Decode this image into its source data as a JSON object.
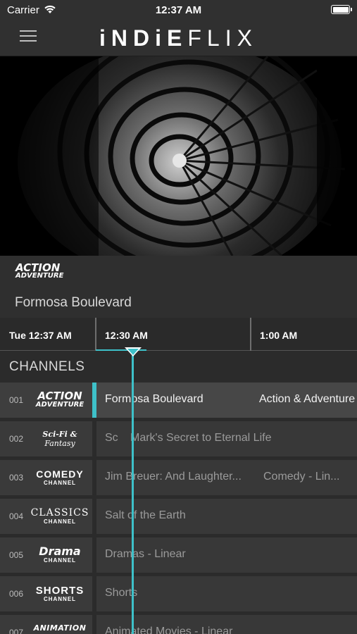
{
  "status_bar": {
    "carrier": "Carrier",
    "time": "12:37 AM"
  },
  "header": {
    "logo_bold": "iNDiE",
    "logo_light": "FLIX"
  },
  "now_playing": {
    "channel_logo_line1": "ACTION",
    "channel_logo_line2": "ADVENTURE",
    "title": "Formosa Boulevard"
  },
  "timeline": {
    "current": "Tue 12:37 AM",
    "slots": [
      "12:30 AM",
      "1:00 AM"
    ]
  },
  "channels_header": "CHANNELS",
  "channels": [
    {
      "number": "001",
      "logo_line1": "ACTION",
      "logo_line2": "ADVENTURE",
      "programs": [
        "Formosa Boulevard",
        "Action & Adventure"
      ],
      "active": true
    },
    {
      "number": "002",
      "logo_line1": "Sci-Fi &",
      "logo_line2": "Fantasy",
      "programs": [
        "Sc",
        "Mark's Secret to Eternal Life"
      ]
    },
    {
      "number": "003",
      "logo_line1": "COMEDY",
      "logo_line2": "CHANNEL",
      "programs": [
        "Jim Breuer: And Laughter...",
        "Comedy - Lin..."
      ]
    },
    {
      "number": "004",
      "logo_line1": "CLASSICS",
      "logo_line2": "CHANNEL",
      "programs": [
        "Salt of the Earth"
      ]
    },
    {
      "number": "005",
      "logo_line1": "Drama",
      "logo_line2": "CHANNEL",
      "programs": [
        "Dramas - Linear"
      ]
    },
    {
      "number": "006",
      "logo_line1": "SHORTS",
      "logo_line2": "CHANNEL",
      "programs": [
        "Shorts"
      ]
    },
    {
      "number": "007",
      "logo_line1": "ANIMATION",
      "programs": [
        "Animated Movies - Linear"
      ]
    }
  ],
  "colors": {
    "accent": "#3ec1c9",
    "background": "#2b2b2b"
  },
  "icons": [
    "wifi-icon",
    "battery-icon",
    "hamburger-menu-icon",
    "playhead-marker-icon"
  ]
}
